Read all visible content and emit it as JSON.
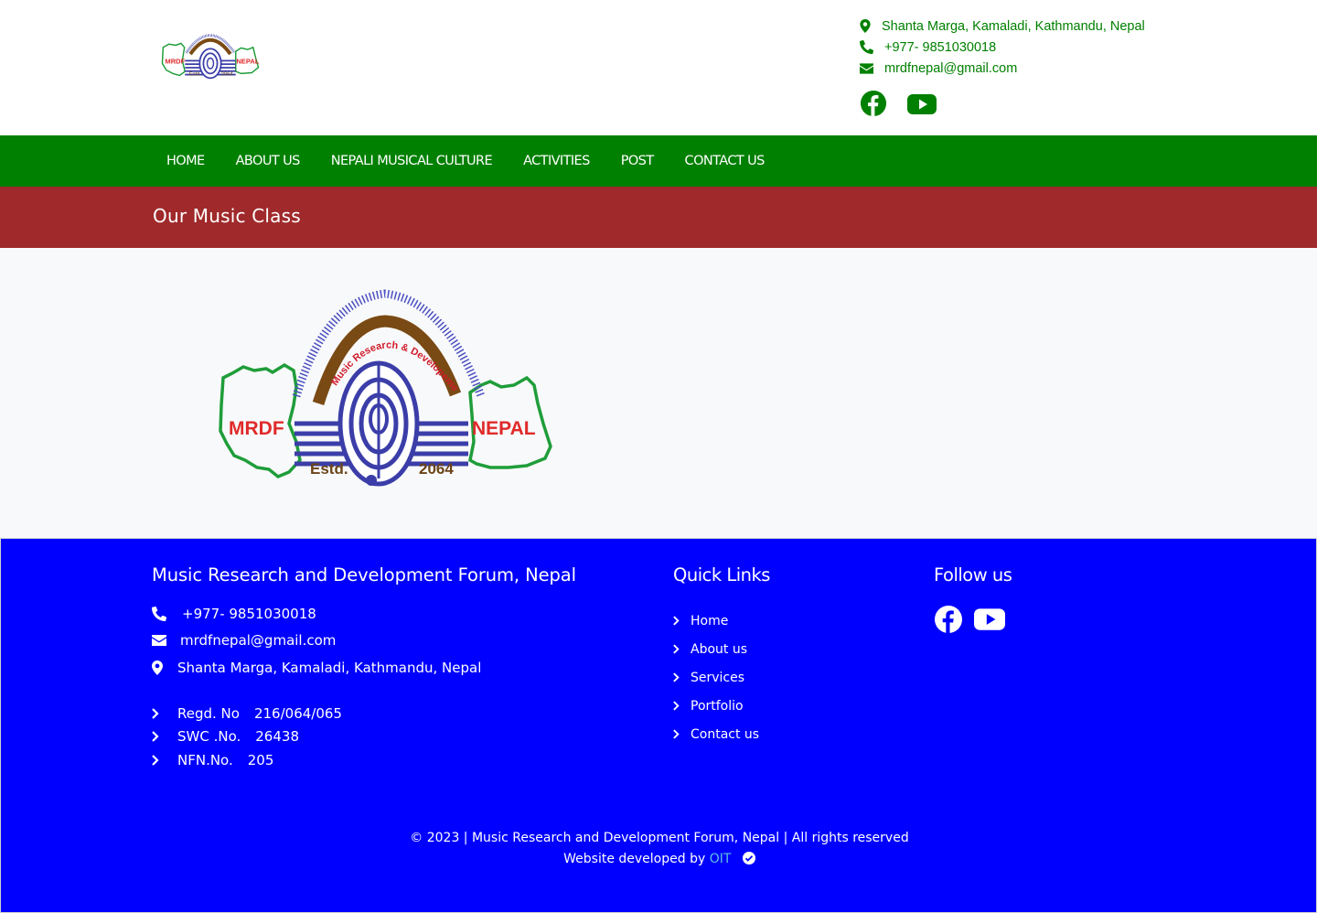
{
  "header": {
    "logo_text": {
      "left": "MRDF",
      "right": "NEPAL",
      "estd": "Estd.",
      "year": "2064"
    },
    "address": "Shanta Marga, Kamaladi, Kathmandu, Nepal",
    "phone": "+977- 9851030018",
    "email": "mrdfnepal@gmail.com",
    "social_icons": [
      "facebook-icon",
      "youtube-icon"
    ]
  },
  "nav": {
    "items": [
      {
        "label": "HOME"
      },
      {
        "label": "ABOUT US"
      },
      {
        "label": "NEPALI MUSICAL CULTURE"
      },
      {
        "label": "ACTIVITIES"
      },
      {
        "label": "POST"
      },
      {
        "label": "CONTACT US"
      }
    ]
  },
  "page": {
    "title": "Our Music Class",
    "logo_text": {
      "arc": "Music Research & Developement Forum, Nepal",
      "left": "MRDF",
      "right": "NEPAL",
      "estd": "Estd.",
      "year": "2064"
    }
  },
  "footer": {
    "org_title": "Music Research and Development Forum, Nepal",
    "phone": "+977- 9851030018",
    "email": "mrdfnepal@gmail.com",
    "address": "Shanta Marga, Kamaladi, Kathmandu, Nepal",
    "registrations": [
      {
        "label": "Regd. No",
        "value": "216/064/065"
      },
      {
        "label": "SWC .No.",
        "value": "26438"
      },
      {
        "label": "NFN.No.",
        "value": "205"
      }
    ],
    "quick_links_title": "Quick Links",
    "quick_links": [
      {
        "label": "Home"
      },
      {
        "label": "About us"
      },
      {
        "label": "Services"
      },
      {
        "label": "Portfolio"
      },
      {
        "label": "Contact us"
      }
    ],
    "follow_title": "Follow us",
    "copyright": "© 2023 | Music Research and Development Forum, Nepal | All rights reserved",
    "developed_by": "Website developed by",
    "developer": "OIT"
  },
  "colors": {
    "green": "#008000",
    "maroon": "#a0292b",
    "footer_blue": "#0000ff",
    "content_bg": "#f8f9fa",
    "link_cyan": "#5bc0de"
  }
}
